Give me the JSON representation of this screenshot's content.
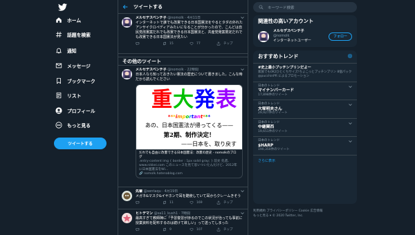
{
  "nav": {
    "items": [
      {
        "label": "ホーム"
      },
      {
        "label": "話題を検索"
      },
      {
        "label": "通知"
      },
      {
        "label": "メッセージ"
      },
      {
        "label": "ブックマーク"
      },
      {
        "label": "リスト"
      },
      {
        "label": "プロフィール"
      },
      {
        "label": "もっと見る"
      }
    ],
    "tweet_button": "ツイートする"
  },
  "main": {
    "header_title": "ツイートする",
    "section_title": "その他のツイート",
    "tweet1": {
      "name": "メルセデスベンチ子",
      "handle": "@nomolk · 4月11日",
      "text": "インターネットで誰でも改憲できる日本国憲法をやるとタダの外れたアンサイクロペディアみたいになることが分かったので、こんどは自民党改憲案だれでも改憲できる日本国憲法と、共産党発案限定だれでも改憲できる日本国憲法が見たい",
      "replies": "",
      "retweets": "15",
      "likes": "77",
      "share": "チップ"
    },
    "tweet2": {
      "name": "メルセデスベンチ子",
      "handle": "@nomolk · 22時間",
      "text": "日本人なら知っておきたい憲法の歴史について書きました。こんな時だから読んでください",
      "media_title": [
        "重",
        "大",
        "発",
        "表"
      ],
      "media_title_colors": [
        "#ff0000",
        "#00c000",
        "#0000ff",
        "#9900ff"
      ],
      "media_sub": [
        "*",
        "*",
        "*",
        "i",
        "m",
        "p",
        "o",
        "r",
        "t",
        "a",
        "n",
        "t",
        "*",
        "*",
        "*"
      ],
      "media_sub_colors": [
        "#ff0000",
        "#ff8800",
        "#ffcc00",
        "#ff0000",
        "#ff8800",
        "#ffcc00",
        "#00c000",
        "#0088ff",
        "#0000ff",
        "#9900ff",
        "#ff00ff",
        "#ff0000",
        "#ff8800",
        "#00c000",
        "#0000ff"
      ],
      "media_line1": "あの、日本国憲法が帰ってくる——",
      "media_line2": "第2期、制作決定！",
      "media_line3": "——日本を、取り戻す",
      "card_title": "だれでも自由に改憲できる日本国憲法：改憲の歴史 - nomolkのブログ",
      "card_desc": ".entry-content img { border : 1px solid gray; } 前文 先週、www.nikkei.com このニュースを見て思いついたんだけど、2012年に日本国憲法をWi...",
      "card_domain": "nomolk.hatenablog.com"
    },
    "tweet3": {
      "name": "先輩",
      "handle": "@sentaqu · 4月19日",
      "text": "メガネ&マスク&イヤホンで耳を酷使していて耳からクレームきそう",
      "replies": "",
      "retweets": "11",
      "likes": "169",
      "share": "チップ"
    },
    "tweet4": {
      "name": "ヒトデマン",
      "handle": "@sa11_kush1 · 7時間",
      "text": "最高すぎて教師陣に「予習復習が捗るのでこの状況が治っても事前に授業資料を配布するのは続けて欲しい」って送ってしまった",
      "replies": "",
      "retweets": "9",
      "likes": "107",
      "share": "チップ"
    }
  },
  "right": {
    "search_placeholder": "キーワード検索",
    "related_title": "関連性の高いアカウント",
    "account_name": "メルセデスベンチ子",
    "account_handle": "@nomolk",
    "account_bio": "インターネットユーザー",
    "follow_label": "フォロー",
    "trends_title": "おすすめトレンド",
    "trends": [
      {
        "name": "#史上最小プッチンプリンだよー",
        "desc": "家族でも0K2ひとくちサイズ!ちょこっとプッチンプリン 8個パック",
        "meta": "@pucchinPR によるプロモーション"
      },
      {
        "small": "日本のトレンド",
        "name": "マイナンバーカード",
        "meta": "17,898件のツイート"
      },
      {
        "small": "日本のトレンド",
        "name": "大塚明夫さん",
        "meta": "29,927件のツイート"
      },
      {
        "small": "日本のトレンド",
        "name": "中継関西",
        "meta": "19,651件のツイート"
      },
      {
        "small": "日本のトレンド",
        "name": "$HARP",
        "meta": "190,350件のツイート"
      }
    ],
    "more_label": "さらに表示",
    "footer_line1": "利用規約  プライバシーポリシー  Cookie  広告情報",
    "footer_line2": "もっと見る ▾    © 2020 Twitter, Inc."
  }
}
